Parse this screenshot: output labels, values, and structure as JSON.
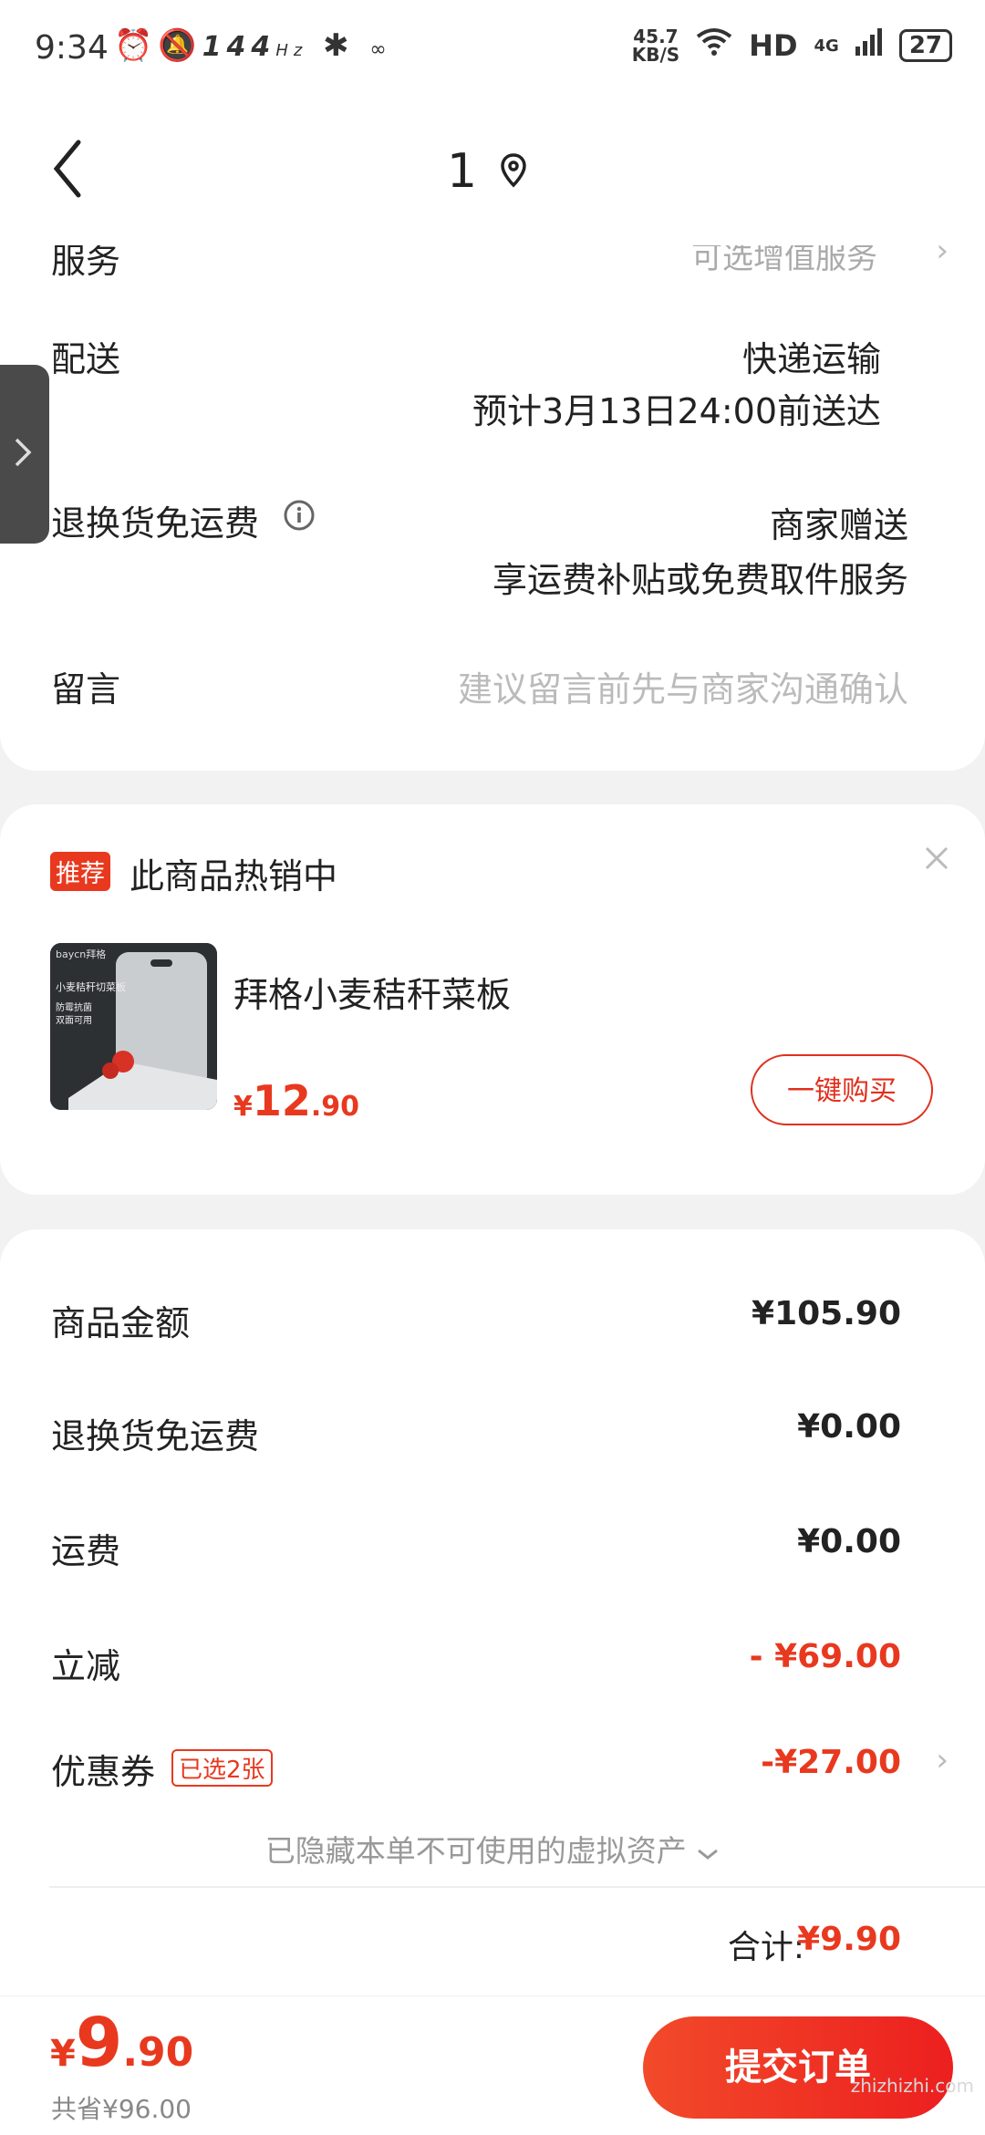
{
  "status_bar": {
    "time": "9:34",
    "refresh_rate": "144",
    "refresh_unit": "Hz",
    "net_speed": "45.7",
    "net_unit": "KB/S",
    "hd": "HD",
    "network": "4G",
    "battery": "27"
  },
  "header": {
    "title": "1"
  },
  "order_info": {
    "service_label": "服务",
    "service_value": "可选增值服务",
    "delivery_label": "配送",
    "delivery_value": "快递运输",
    "delivery_eta": "预计3月13日24:00前送达",
    "return_label": "退换货免运费",
    "return_value": "商家赠送",
    "return_desc": "享运费补贴或免费取件服务",
    "message_label": "留言",
    "message_placeholder": "建议留言前先与商家沟通确认"
  },
  "recommend": {
    "tag": "推荐",
    "title": "此商品热销中",
    "product_name": "拜格小麦秸秆菜板",
    "currency": "¥",
    "price_int": "12",
    "price_dec": ".90",
    "buy_label": "一键购买",
    "img_text_brand": "baycn拜格",
    "img_text_title": "小麦秸秆切菜板",
    "img_text_sub1": "防霉抗菌",
    "img_text_sub2": "双面可用"
  },
  "summary": {
    "goods_label": "商品金额",
    "goods_value": "¥105.90",
    "return_label": "退换货免运费",
    "return_value": "¥0.00",
    "shipping_label": "运费",
    "shipping_value": "¥0.00",
    "discount_label": "立减",
    "discount_value": "- ¥69.00",
    "coupon_label": "优惠券",
    "coupon_tag": "已选2张",
    "coupon_value": "-¥27.00",
    "hidden_assets": "已隐藏本单不可使用的虚拟资产",
    "total_label": "合计:",
    "total_value": "¥9.90"
  },
  "bottom": {
    "currency": "¥",
    "price_int": "9",
    "price_dec": ".90",
    "saved": "共省¥96.00",
    "submit_label": "提交订单",
    "watermark": "zhizhizhi.com"
  },
  "colors": {
    "accent": "#e8391f",
    "muted": "#aaaaaa"
  }
}
